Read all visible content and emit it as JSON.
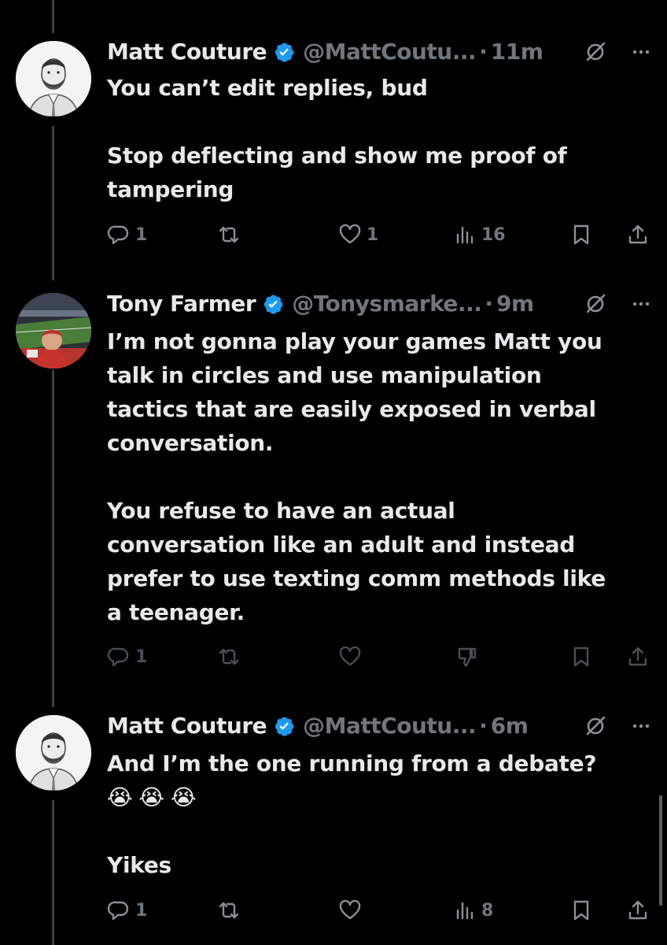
{
  "tweets": [
    {
      "name": "Matt Couture",
      "handle": "@MattCoutu...",
      "time": "11m",
      "paragraphs": [
        "You can’t edit replies, bud",
        "Stop deflecting and show me proof of\ntampering"
      ],
      "emojis": [],
      "after_emojis": "",
      "replies": "1",
      "retweets": "",
      "likes": "1",
      "views": "16"
    },
    {
      "name": "Tony Farmer",
      "handle": "@Tonysmarke...",
      "time": "9m",
      "paragraphs": [
        "I’m not gonna play your games Matt you\ntalk in circles and use manipulation\ntactics that are easily exposed in verbal\nconversation.",
        "You refuse to have an actual\nconversation like an adult and instead\nprefer to use texting comm methods like\na teenager."
      ],
      "emojis": [],
      "after_emojis": "",
      "replies": "1",
      "retweets": "",
      "likes": "",
      "views": ""
    },
    {
      "name": "Matt Couture",
      "handle": "@MattCoutu...",
      "time": "6m",
      "paragraphs": [
        "And I’m the one running from a debate?"
      ],
      "emojis": [
        "😭",
        "😭",
        "😭"
      ],
      "after_emojis": "Yikes",
      "replies": "1",
      "retweets": "",
      "likes": "",
      "views": "8"
    }
  ],
  "icons": {
    "verified": "verified-badge-icon",
    "grok": "grok-icon",
    "more": "more-icon",
    "reply": "reply-icon",
    "retweet": "retweet-icon",
    "like": "like-icon",
    "views": "views-icon",
    "downvote": "downvote-icon",
    "bookmark": "bookmark-icon",
    "share": "share-icon"
  },
  "colors": {
    "background": "#000000",
    "text": "#e7e9ea",
    "secondary": "#71767b",
    "verified": "#1d9bf0",
    "thread_line": "#3a3f44"
  }
}
